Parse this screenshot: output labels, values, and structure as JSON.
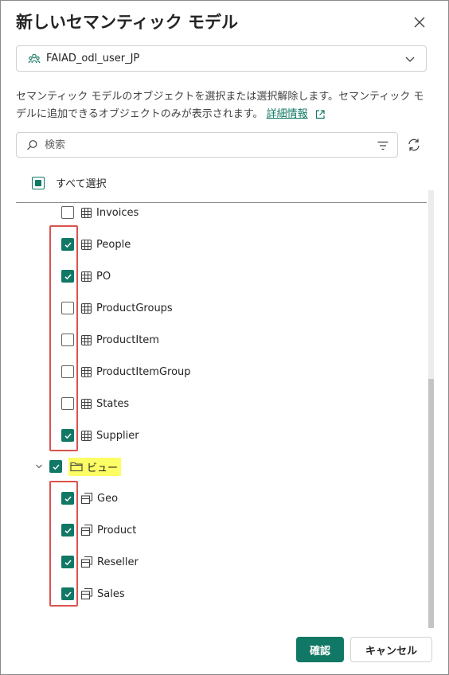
{
  "dialog": {
    "title": "新しいセマンティック モデル",
    "workspace": "FAIAD_odl_user_JP",
    "description": "セマンティック モデルのオブジェクトを選択または選択解除します。セマンティック モデルに追加できるオブジェクトのみが表示されます。",
    "learn_more": "詳細情報",
    "search_placeholder": "検索",
    "select_all": "すべて選択",
    "select_all_state": "mixed",
    "tables": [
      {
        "name": "Invoices",
        "checked": false
      },
      {
        "name": "People",
        "checked": true
      },
      {
        "name": "PO",
        "checked": true
      },
      {
        "name": "ProductGroups",
        "checked": false
      },
      {
        "name": "ProductItem",
        "checked": false
      },
      {
        "name": "ProductItemGroup",
        "checked": false
      },
      {
        "name": "States",
        "checked": false
      },
      {
        "name": "Supplier",
        "checked": true
      }
    ],
    "views_folder": {
      "name": "ビュー",
      "checked": true,
      "expanded": true
    },
    "views": [
      {
        "name": "Geo",
        "checked": true
      },
      {
        "name": "Product",
        "checked": true
      },
      {
        "name": "Reseller",
        "checked": true
      },
      {
        "name": "Sales",
        "checked": true
      }
    ],
    "confirm_label": "確認",
    "cancel_label": "キャンセル"
  },
  "colors": {
    "accent": "#117865",
    "highlight": "#fdfd65",
    "annotation_red": "#d9534f"
  },
  "icons": {
    "close": "close-icon",
    "workspace": "people-group-icon",
    "dropdown": "chevron-down-icon",
    "external": "open-external-icon",
    "search": "search-icon",
    "filter": "filter-icon",
    "refresh": "refresh-icon",
    "table": "table-icon",
    "view": "view-icon",
    "folder": "folder-icon"
  }
}
